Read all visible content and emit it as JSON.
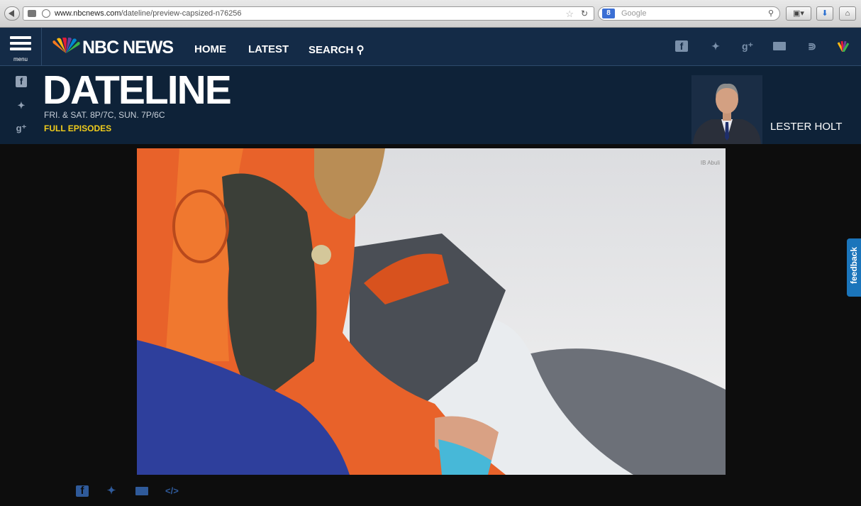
{
  "browser": {
    "url_domain": "www.nbcnews.com",
    "url_path": "/dateline/preview-capsized-n76256",
    "search_engine": "Google",
    "search_placeholder": "Google"
  },
  "header": {
    "menu_label": "menu",
    "brand": "NBC NEWS",
    "nav": [
      "HOME",
      "LATEST",
      "SEARCH"
    ],
    "social_icons": [
      "facebook-icon",
      "twitter-icon",
      "google-plus-icon",
      "email-icon",
      "rss-icon",
      "peacock-color-icon"
    ]
  },
  "show": {
    "title": "DATELINE",
    "schedule": "FRI. & SAT. 8P/7C, SUN. 7P/6C",
    "episodes_link": "FULL EPISODES",
    "host_name": "LESTER HOLT",
    "side_social_icons": [
      "facebook-icon",
      "twitter-icon",
      "google-plus-icon"
    ]
  },
  "video": {
    "credit": "IB Abuli"
  },
  "feedback_label": "feedback",
  "share_icons": [
    "facebook-icon",
    "twitter-icon",
    "email-icon",
    "embed-icon"
  ],
  "colors": {
    "header_bg": "#142b47",
    "show_bg": "#0e2238",
    "accent_yellow": "#f0cc1c",
    "feedback_blue": "#1b75bb"
  }
}
